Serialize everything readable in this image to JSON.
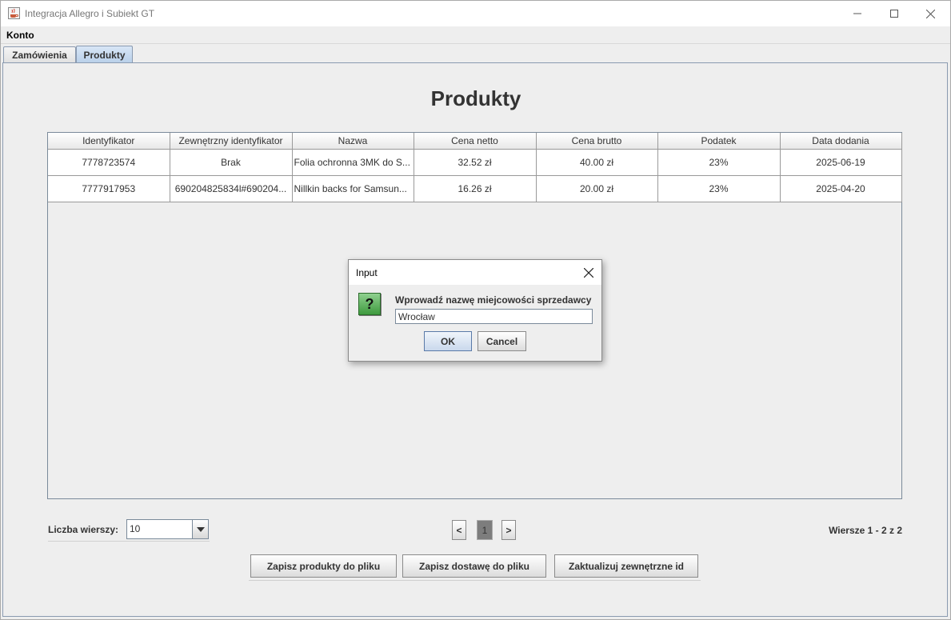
{
  "window": {
    "title": "Integracja Allegro i Subiekt GT",
    "app_icon": "java-cup-icon"
  },
  "menubar": {
    "konto": "Konto"
  },
  "tabs": [
    {
      "label": "Zamówienia",
      "active": false
    },
    {
      "label": "Produkty",
      "active": true
    }
  ],
  "page": {
    "title": "Produkty"
  },
  "table": {
    "columns": [
      "Identyfikator",
      "Zewnętrzny identyfikator",
      "Nazwa",
      "Cena netto",
      "Cena brutto",
      "Podatek",
      "Data dodania"
    ],
    "rows": [
      [
        "7778723574",
        "Brak",
        "Folia ochronna 3MK do S...",
        "32.52 zł",
        "40.00 zł",
        "23%",
        "2025-06-19"
      ],
      [
        "7777917953",
        "690204825834l#690204...",
        "Nillkin backs for Samsun...",
        "16.26 zł",
        "20.00 zł",
        "23%",
        "2025-04-20"
      ]
    ]
  },
  "pagination": {
    "rows_label": "Liczba wierszy:",
    "rows_value": "10",
    "prev": "<",
    "current": "1",
    "next": ">",
    "rows_info": "Wiersze 1 - 2 z 2"
  },
  "actions": {
    "save_products": "Zapisz produkty do pliku",
    "save_delivery": "Zapisz dostawę do pliku",
    "update_ids": "Zaktualizuj zewnętrzne id"
  },
  "dialog": {
    "title": "Input",
    "message": "Wprowadź nazwę miejcowości sprzedawcy",
    "input_value": "Wrocław",
    "ok": "OK",
    "cancel": "Cancel",
    "icon": "question-icon"
  }
}
